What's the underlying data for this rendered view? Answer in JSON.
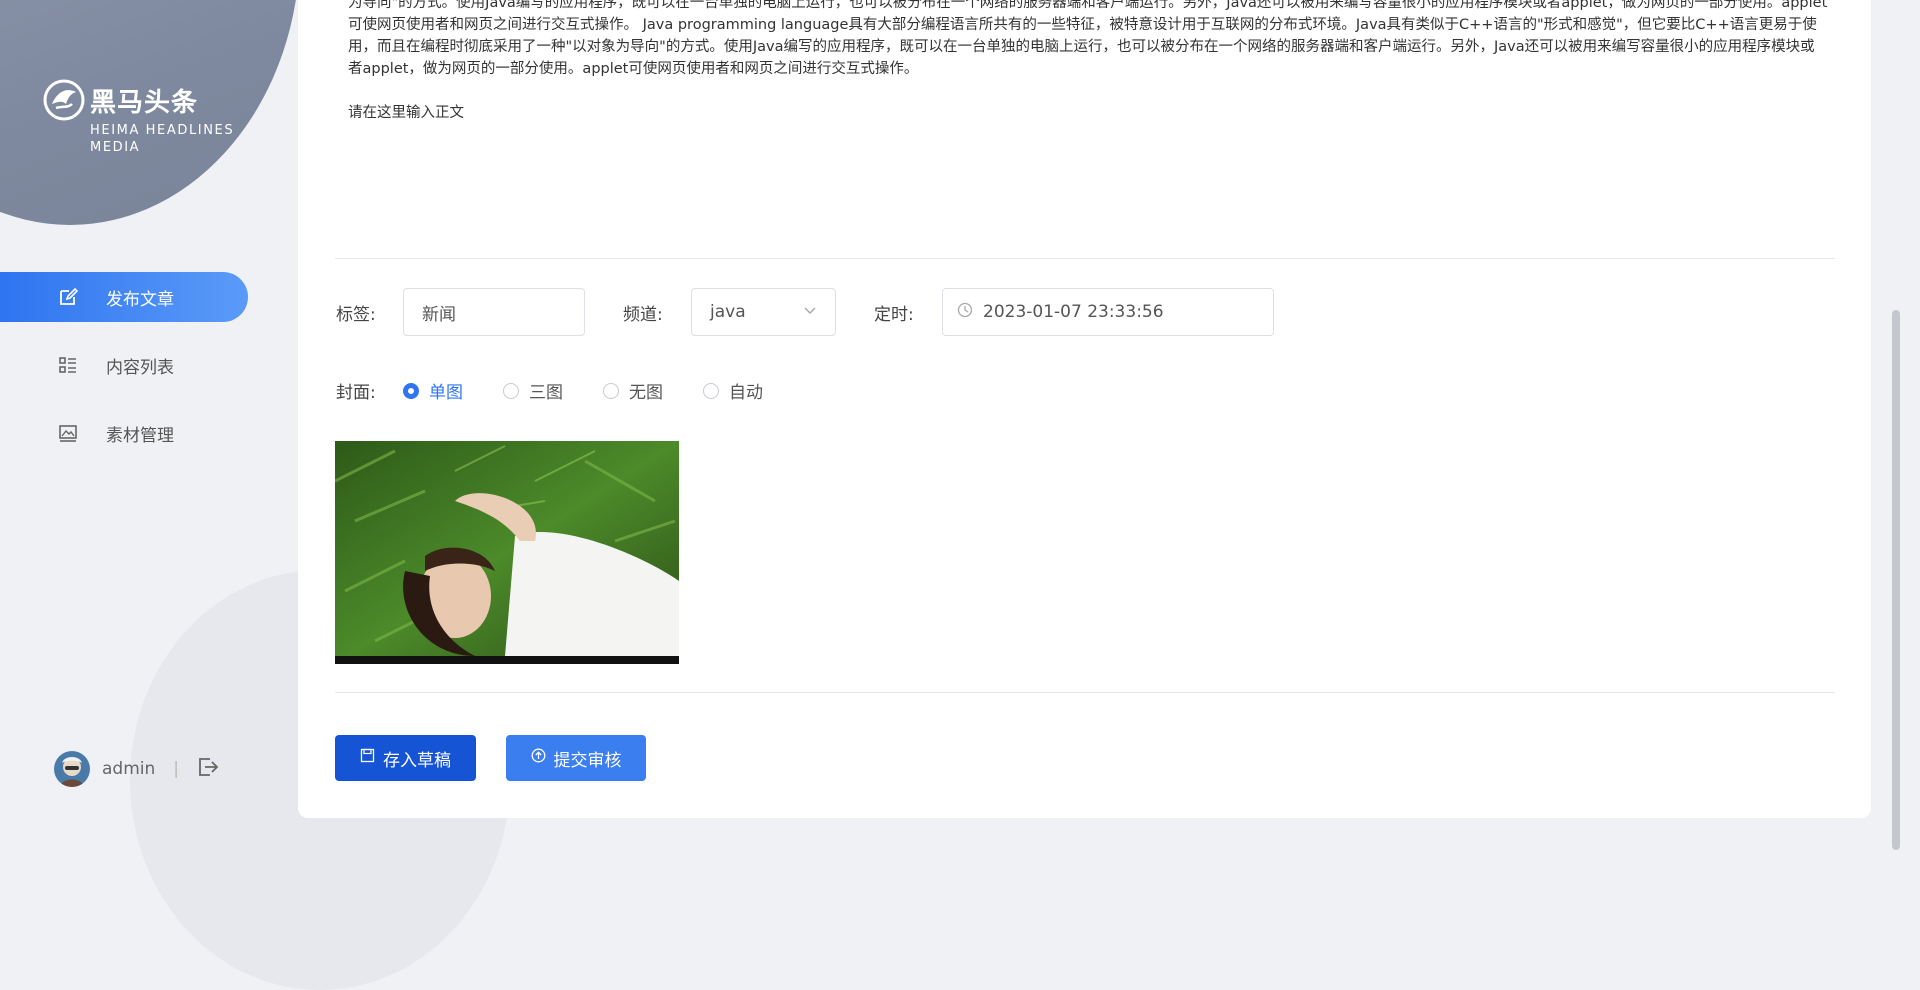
{
  "brand": {
    "title": "黑马头条",
    "subtitle": "HEIMA HEADLINES MEDIA"
  },
  "sidebar": {
    "items": [
      {
        "label": "发布文章",
        "icon": "edit-icon",
        "active": true
      },
      {
        "label": "内容列表",
        "icon": "list-icon",
        "active": false
      },
      {
        "label": "素材管理",
        "icon": "image-icon",
        "active": false
      }
    ]
  },
  "user": {
    "name": "admin",
    "separator": "|"
  },
  "editor": {
    "paragraphs": [
      "为导向\"的方式。使用Java编写的应用程序，既可以在一台单独的电脑上运行，也可以被分布在一个网络的服务器端和客户端运行。另外，Java还可以被用来编写容量很小的应用程序模块或者applet，做为网页的一部分使用。applet可使网页使用者和网页之间进行交互式操作。 Java programming language具有大部分编程语言所共有的一些特征，被特意设计用于互联网的分布式环境。Java具有类似于C++语言的\"形式和感觉\"，但它要比C++语言更易于使用，而且在编程时彻底采用了一种\"以对象为导向\"的方式。使用Java编写的应用程序，既可以在一台单独的电脑上运行，也可以被分布在一个网络的服务器端和客户端运行。另外，Java还可以被用来编写容量很小的应用程序模块或者applet，做为网页的一部分使用。applet可使网页使用者和网页之间进行交互式操作。"
    ],
    "placeholder_line": "请在这里输入正文"
  },
  "form": {
    "tag_label": "标签:",
    "tag_value": "新闻",
    "channel_label": "频道:",
    "channel_value": "java",
    "timer_label": "定时:",
    "timer_value": "2023-01-07 23:33:56",
    "cover_label": "封面:",
    "cover_options": [
      {
        "label": "单图",
        "checked": true
      },
      {
        "label": "三图",
        "checked": false
      },
      {
        "label": "无图",
        "checked": false
      },
      {
        "label": "自动",
        "checked": false
      }
    ]
  },
  "buttons": {
    "draft": "存入草稿",
    "submit": "提交审核"
  },
  "colors": {
    "primary": "#2f74f0",
    "draft_button": "#1654d6",
    "sidebar_blob": "#8c95aa"
  }
}
